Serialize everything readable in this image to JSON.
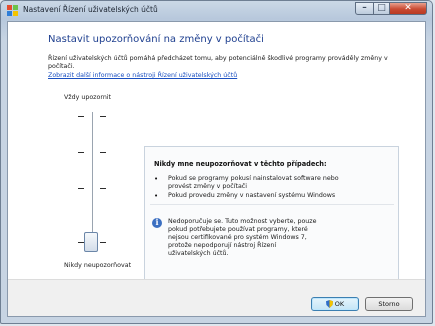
{
  "window": {
    "title": "Nastavení Řízení uživatelských účtů",
    "controls": {
      "minimize": "–",
      "maximize": "□",
      "close": "✕"
    }
  },
  "main": {
    "heading": "Nastavit upozorňování na změny v počítači",
    "description": "Řízení uživatelských účtů pomáhá předcházet tomu, aby potenciálně škodlivé programy prováděly změny v počítači.",
    "link": "Zobrazit další informace o nástroji Řízení uživatelských účtů"
  },
  "slider": {
    "top_label": "Vždy upozornit",
    "bottom_label": "Nikdy neupozorňovat",
    "level_count": 4,
    "selected_level": 0
  },
  "panel": {
    "heading": "Nikdy mne neupozorňovat v těchto případech:",
    "bullets": [
      "Pokud se programy pokusí nainstalovat software nebo provést změny v počítači",
      "Pokud provedu změny v nastavení systému Windows"
    ],
    "bullet_glyph": "•",
    "info_glyph": "i",
    "note": "Nedoporučuje se. Tuto možnost vyberte, pouze pokud potřebujete používat programy, které nejsou certifikované pro systém Windows 7, protože nepodporují nástroj Řízení uživatelských účtů."
  },
  "buttons": {
    "ok": "OK",
    "cancel": "Storno"
  },
  "icons": {
    "title": "uac-settings-icon",
    "ok": "uac-shield-icon",
    "info": "info-icon"
  },
  "colors": {
    "heading": "#1e3f8f",
    "link": "#1a4fc0",
    "close": "#c94a32"
  }
}
